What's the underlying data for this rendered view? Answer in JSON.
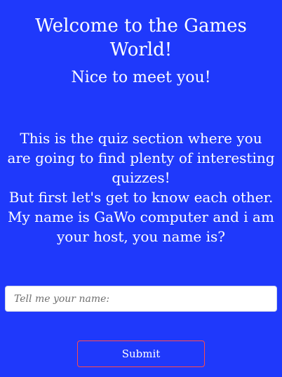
{
  "header": {
    "title": "Welcome to the Games World!",
    "subtitle": "Nice to meet you!"
  },
  "intro": {
    "lines": [
      "This is the quiz section where you are going to find plenty of interesting quizzes!",
      "But first let's get to know each other.",
      "My name is GaWo computer and i am your host, you name is?"
    ]
  },
  "form": {
    "name_placeholder": "Tell me your name:",
    "name_value": "",
    "submit_label": "Submit"
  },
  "colors": {
    "background": "#1f39fb",
    "text": "#ffffff",
    "button_border": "#ff4a4a"
  }
}
